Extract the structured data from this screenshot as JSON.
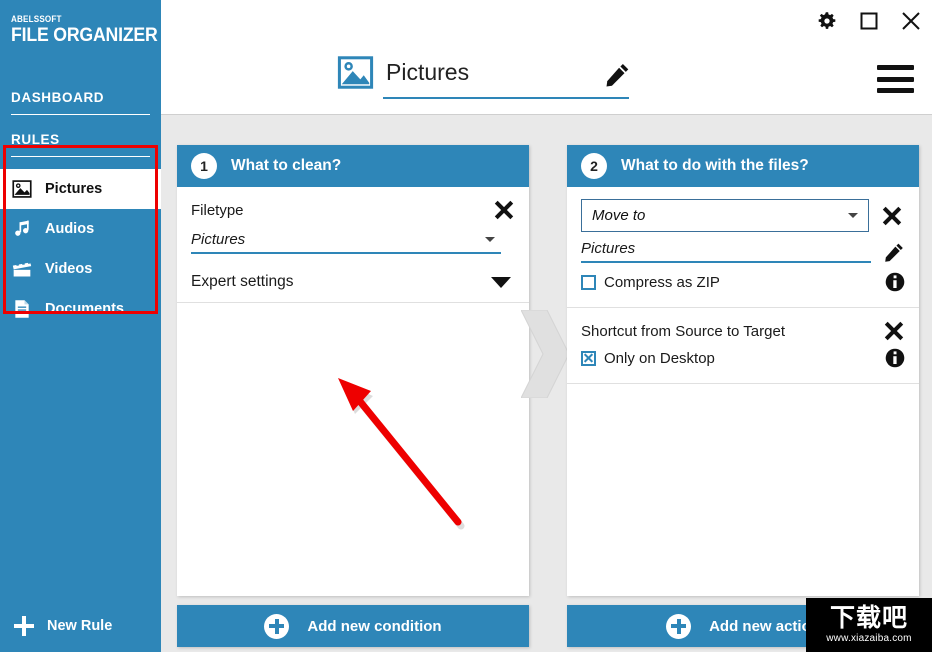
{
  "app": {
    "brand_top": "ABELSSOFT",
    "brand_main": "FILE ORGANIZER",
    "accent_color": "#2E86B8",
    "annotation_color": "#EE0000"
  },
  "sidebar": {
    "sections": [
      {
        "label": "DASHBOARD"
      },
      {
        "label": "RULES"
      }
    ],
    "rules": [
      {
        "label": "Pictures",
        "icon": "picture-icon",
        "active": true
      },
      {
        "label": "Audios",
        "icon": "music-note-icon",
        "active": false
      },
      {
        "label": "Videos",
        "icon": "film-clapper-icon",
        "active": false
      },
      {
        "label": "Documents",
        "icon": "document-icon",
        "active": false
      }
    ],
    "new_rule_label": "New Rule"
  },
  "titlebar": {
    "settings_icon": "gear-icon",
    "maximize_icon": "maximize-icon",
    "close_icon": "close-icon"
  },
  "header": {
    "icon": "picture-icon",
    "title": "Pictures",
    "edit_icon": "pencil-icon",
    "menu_icon": "hamburger-menu-icon"
  },
  "panels": [
    {
      "step": "1",
      "title": "What to clean?",
      "condition_label": "Filetype",
      "condition_value": "Pictures",
      "expert_label": "Expert settings",
      "add_button": "Add new condition"
    },
    {
      "step": "2",
      "title": "What to do with the files?",
      "action_value": "Move to",
      "target_path": "Pictures",
      "compress_label": "Compress as ZIP",
      "compress_checked": false,
      "shortcut_label": "Shortcut from Source to Target",
      "desktop_label": "Only on Desktop",
      "desktop_checked": true,
      "add_button": "Add new action"
    }
  ],
  "watermark": {
    "text_cn": "下载吧",
    "url": "www.xiazaiba.com"
  }
}
